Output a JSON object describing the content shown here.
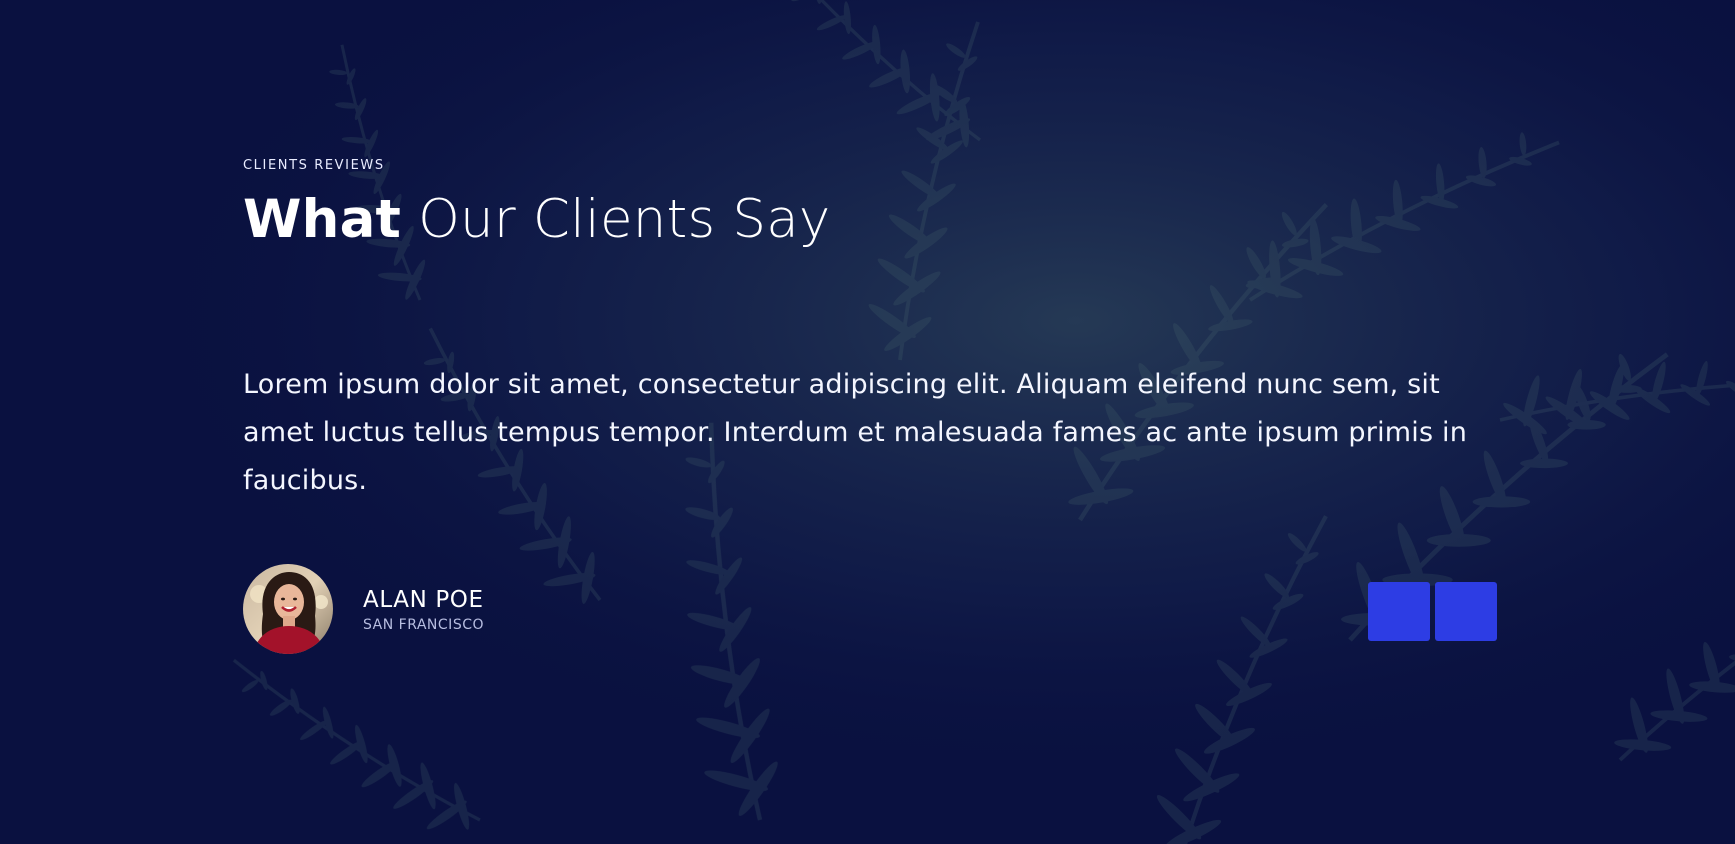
{
  "section": {
    "eyebrow": "CLIENTS REVIEWS",
    "heading_strong": "What",
    "heading_rest": " Our Clients Say"
  },
  "testimonial": {
    "quote": "Lorem ipsum dolor sit amet, consectetur adipiscing elit. Aliquam eleifend nunc sem, sit amet luctus tellus tempus tempor. Interdum et malesuada fames ac ante ipsum primis in faucibus.",
    "author_name": "ALAN POE",
    "author_city": "SAN FRANCISCO"
  },
  "icons": {
    "background": "fern-leaves-background",
    "avatar": "client-portrait-avatar"
  },
  "colors": {
    "background": "#0a1140",
    "accent": "#2d3de4",
    "text": "#ffffff",
    "muted_text": "#b7bde0"
  }
}
